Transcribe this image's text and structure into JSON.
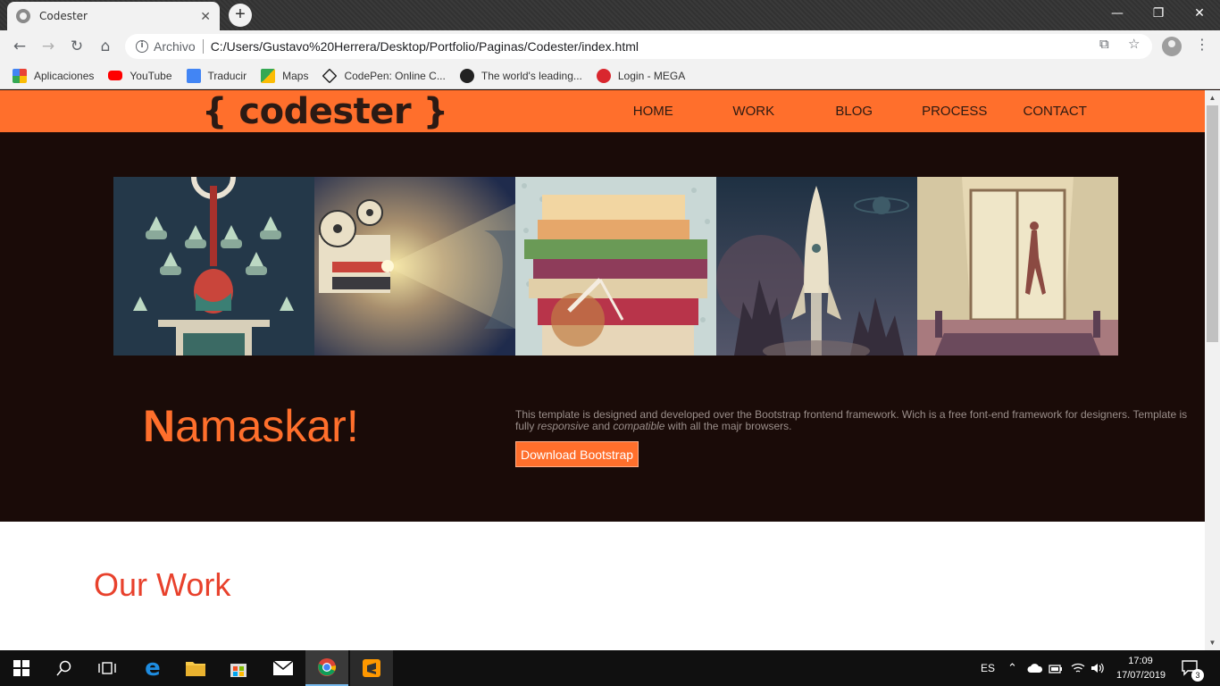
{
  "browser": {
    "tab_title": "Codester",
    "tab_close": "✕",
    "new_tab": "+",
    "window_controls": {
      "minimize": "—",
      "restore": "❐",
      "close": "✕"
    },
    "address": {
      "scheme_label": "Archivo",
      "url": "C:/Users/Gustavo%20Herrera/Desktop/Portfolio/Paginas/Codester/index.html"
    },
    "bookmarks": [
      {
        "label": "Aplicaciones",
        "icon": "apps-grid-icon",
        "color": "#e94235"
      },
      {
        "label": "YouTube",
        "icon": "youtube-icon",
        "color": "#ff0000"
      },
      {
        "label": "Traducir",
        "icon": "translate-icon",
        "color": "#4285f4"
      },
      {
        "label": "Maps",
        "icon": "maps-icon",
        "color": "#34a853"
      },
      {
        "label": "CodePen: Online C...",
        "icon": "codepen-icon",
        "color": "#222222"
      },
      {
        "label": "The world's leading...",
        "icon": "github-icon",
        "color": "#222222"
      },
      {
        "label": "Login - MEGA",
        "icon": "mega-icon",
        "color": "#d9272e"
      }
    ]
  },
  "site": {
    "logo": "{ codester }",
    "nav": [
      "HOME",
      "WORK",
      "BLOG",
      "PROCESS",
      "CONTACT"
    ],
    "hero": {
      "heading_first": "N",
      "heading_rest": "amaskar!",
      "intro_part1": "This template is designed and developed over the Bootstrap frontend framework. Wich is a free font-end framework for designers. Template is fully ",
      "intro_em1": "responsive",
      "intro_part2": " and ",
      "intro_em2": "compatible",
      "intro_part3": " with all the majr browsers.",
      "download_button": "Download Bootstrap"
    },
    "work_title": "Our Work",
    "colors": {
      "accent": "#ff6f2c",
      "dark_bg": "#1a0b08",
      "work_title": "#e8412c"
    }
  },
  "taskbar": {
    "language": "ES",
    "time": "17:09",
    "date": "17/07/2019",
    "notifications": "3"
  }
}
